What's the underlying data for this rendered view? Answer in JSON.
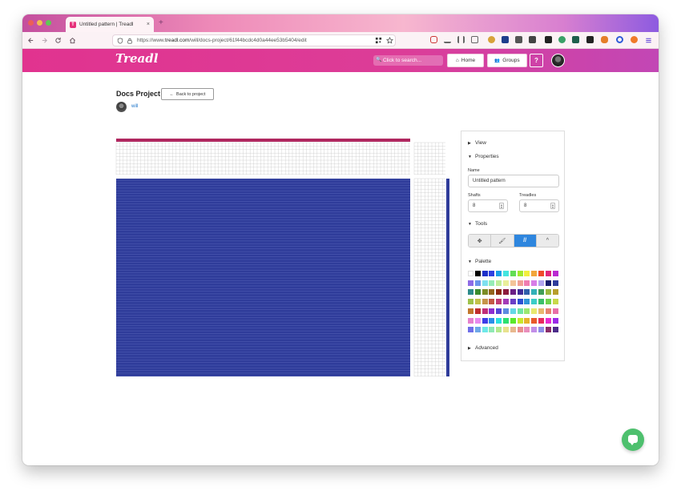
{
  "browser": {
    "tab_title": "Untitled pattern | Treadl",
    "tab_favicon": "T",
    "tab_close": "×",
    "new_tab": "+",
    "url_prefix": "https://www.",
    "url_domain": "treadl.com",
    "url_path": "/will/docs-project/61f44bcdc4d0a44ee53b5404/edit",
    "nav_icons": [
      "back-icon",
      "forward-icon",
      "reload-icon",
      "home-icon"
    ]
  },
  "app": {
    "logo": "Treadl",
    "search_placeholder": "Click to search...",
    "search_icon": "🔍",
    "home_label": "Home",
    "home_icon": "⌂",
    "groups_label": "Groups",
    "groups_icon": "👥",
    "help_label": "?",
    "brand_color": "#e1338f"
  },
  "project": {
    "title": "Docs Project",
    "back_label": "Back to project",
    "back_icon": "←",
    "owner": "will"
  },
  "draft": {
    "warp_color": "#b0275f",
    "weft_color": "#2f3c9a",
    "grid_line_color": "#c9c9c9",
    "tieup_color": "#2f3c9a"
  },
  "panel": {
    "view_label": "View",
    "properties_label": "Properties",
    "name_label": "Name",
    "name_value": "Untitled pattern",
    "shafts_label": "Shafts",
    "shafts_value": "8",
    "treadles_label": "Treadles",
    "treadles_value": "8",
    "tools_label": "Tools",
    "tools": [
      {
        "name": "move-tool",
        "glyph": "✥",
        "active": false
      },
      {
        "name": "paint-tool",
        "glyph": "🖌",
        "active": false
      },
      {
        "name": "straight-draw-tool",
        "glyph": "//",
        "active": true
      },
      {
        "name": "point-draw-tool",
        "glyph": "^",
        "active": false
      }
    ],
    "palette_label": "Palette",
    "advanced_label": "Advanced",
    "caret_open": "▼",
    "caret_closed": "▶",
    "palette_colors": [
      [
        "#ffffff",
        "#000000",
        "#1c2fc9",
        "#2f3fe0",
        "#1a9fe6",
        "#44e5e0",
        "#63dd55",
        "#a2ea2d",
        "#f2ef3d",
        "#f2a53b",
        "#ef4a2a",
        "#e0257b",
        "#bb2ad1"
      ],
      [
        "#8e6ce6",
        "#6b95ea",
        "#7ee0ef",
        "#96ecb6",
        "#c0ee9a",
        "#eaef9a",
        "#f3c499",
        "#f0a095",
        "#f07db1",
        "#d77ee7",
        "#b3a6ee",
        "#161c6e",
        "#2f3c9a"
      ],
      [
        "#2d8a8a",
        "#3a8c2c",
        "#7c8c25",
        "#93641c",
        "#8c2a12",
        "#8c1c3d",
        "#6a1f86",
        "#3f2b97",
        "#2f5eaa",
        "#32b1b8",
        "#3f9e58",
        "#9cb83d",
        "#b89e2c"
      ],
      [
        "#9ec24b",
        "#c4c14a",
        "#c6944a",
        "#c35844",
        "#c23d75",
        "#a33bb7",
        "#6a3fc6",
        "#2c4fd2",
        "#2e95d8",
        "#3ccdc8",
        "#3bbf6a",
        "#70d34b",
        "#c9d84a"
      ],
      [
        "#c2772c",
        "#c12e2e",
        "#c02e7a",
        "#8d2ed0",
        "#5448d8",
        "#5d8ce0",
        "#66d8e6",
        "#6ee5a3",
        "#9be86f",
        "#e8e86f",
        "#e8b86f",
        "#e8836f",
        "#e86fa8"
      ],
      [
        "#e682ce",
        "#e88aef",
        "#3d3de8",
        "#2b8ee8",
        "#2be0e0",
        "#2be070",
        "#5ce82b",
        "#c8e82b",
        "#e8b32b",
        "#e8592b",
        "#e82b5e",
        "#e82bd2",
        "#9a2be8"
      ],
      [
        "#6e6ee8",
        "#6ea8e8",
        "#6ee8e8",
        "#8ee8b4",
        "#b4e88e",
        "#e8e28e",
        "#e8b88e",
        "#e88e8e",
        "#e88ebc",
        "#c28ee8",
        "#8e8ee8",
        "#8a2d6a",
        "#4d2d8a"
      ]
    ]
  }
}
